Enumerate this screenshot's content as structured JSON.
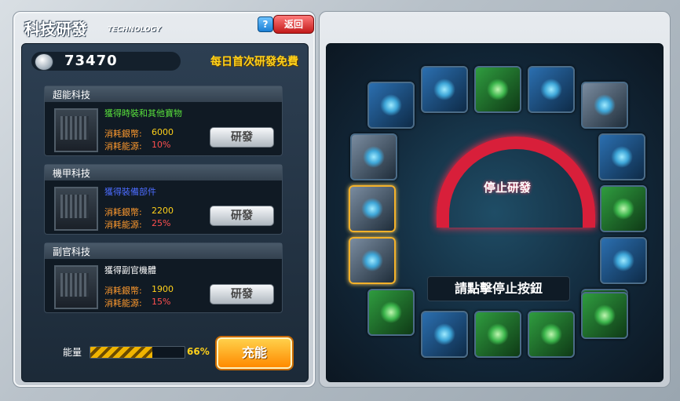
{
  "left_panel": {
    "title": "科技研發",
    "subtitle": "TECHNOLOGY",
    "help_label": "?",
    "back_label": "返回",
    "money_value": "73470",
    "free_text": "每日首次研發免費",
    "cards": [
      {
        "name": "超能科技",
        "desc": "獲得時裝和其他寶物",
        "cost_label": "消耗銀幣:",
        "cost_value": "6000",
        "energy_label": "消耗能源:",
        "energy_value": "10%",
        "button": "研發",
        "desc_color": "#58e03c"
      },
      {
        "name": "機甲科技",
        "desc": "獲得裝備部件",
        "cost_label": "消耗銀幣:",
        "cost_value": "2200",
        "energy_label": "消耗能源:",
        "energy_value": "25%",
        "button": "研發",
        "desc_color": "#4c6cff"
      },
      {
        "name": "副官科技",
        "desc": "獲得副官機體",
        "cost_label": "消耗銀幣:",
        "cost_value": "1900",
        "energy_label": "消耗能源:",
        "energy_value": "15%",
        "button": "研發",
        "desc_color": "#ffffff"
      }
    ],
    "energy_label": "能量",
    "energy_percent": "66%",
    "energy_fraction": 0.66,
    "charge_button": "充能"
  },
  "right_panel": {
    "stop_label": "停止研發",
    "hint_text": "請點擊停止按鈕"
  },
  "parts": [
    {
      "icon": "robot-blue-visor-icon",
      "color": "blue",
      "selected": false
    },
    {
      "icon": "robot-arm-icon",
      "color": "blue",
      "selected": false
    },
    {
      "icon": "robot-green-fist-icon",
      "color": "green",
      "selected": false
    },
    {
      "icon": "robot-blue-visor-icon",
      "color": "blue",
      "selected": false
    },
    {
      "icon": "robot-silver-head-icon",
      "color": "silver",
      "selected": false
    },
    {
      "icon": "robot-silver-head-icon",
      "color": "silver",
      "selected": false
    },
    {
      "icon": "robot-arm-icon",
      "color": "blue",
      "selected": false
    },
    {
      "icon": "robot-drill-icon",
      "color": "silver",
      "selected": true
    },
    {
      "icon": "robot-green-fist-icon",
      "color": "green",
      "selected": false
    },
    {
      "icon": "robot-drill-icon",
      "color": "silver",
      "selected": true
    },
    {
      "icon": "robot-blue-visor-icon",
      "color": "blue",
      "selected": false
    },
    {
      "icon": "robot-green-legs-icon",
      "color": "green",
      "selected": false
    },
    {
      "icon": "robot-green-fist-icon",
      "color": "green",
      "selected": false
    },
    {
      "icon": "robot-blue-visor-icon",
      "color": "blue",
      "selected": false
    },
    {
      "icon": "robot-green-legs-icon",
      "color": "green",
      "selected": false
    },
    {
      "icon": "robot-green-fist-icon",
      "color": "green",
      "selected": false
    },
    {
      "icon": "robot-green-fist-icon",
      "color": "green",
      "selected": false
    }
  ]
}
